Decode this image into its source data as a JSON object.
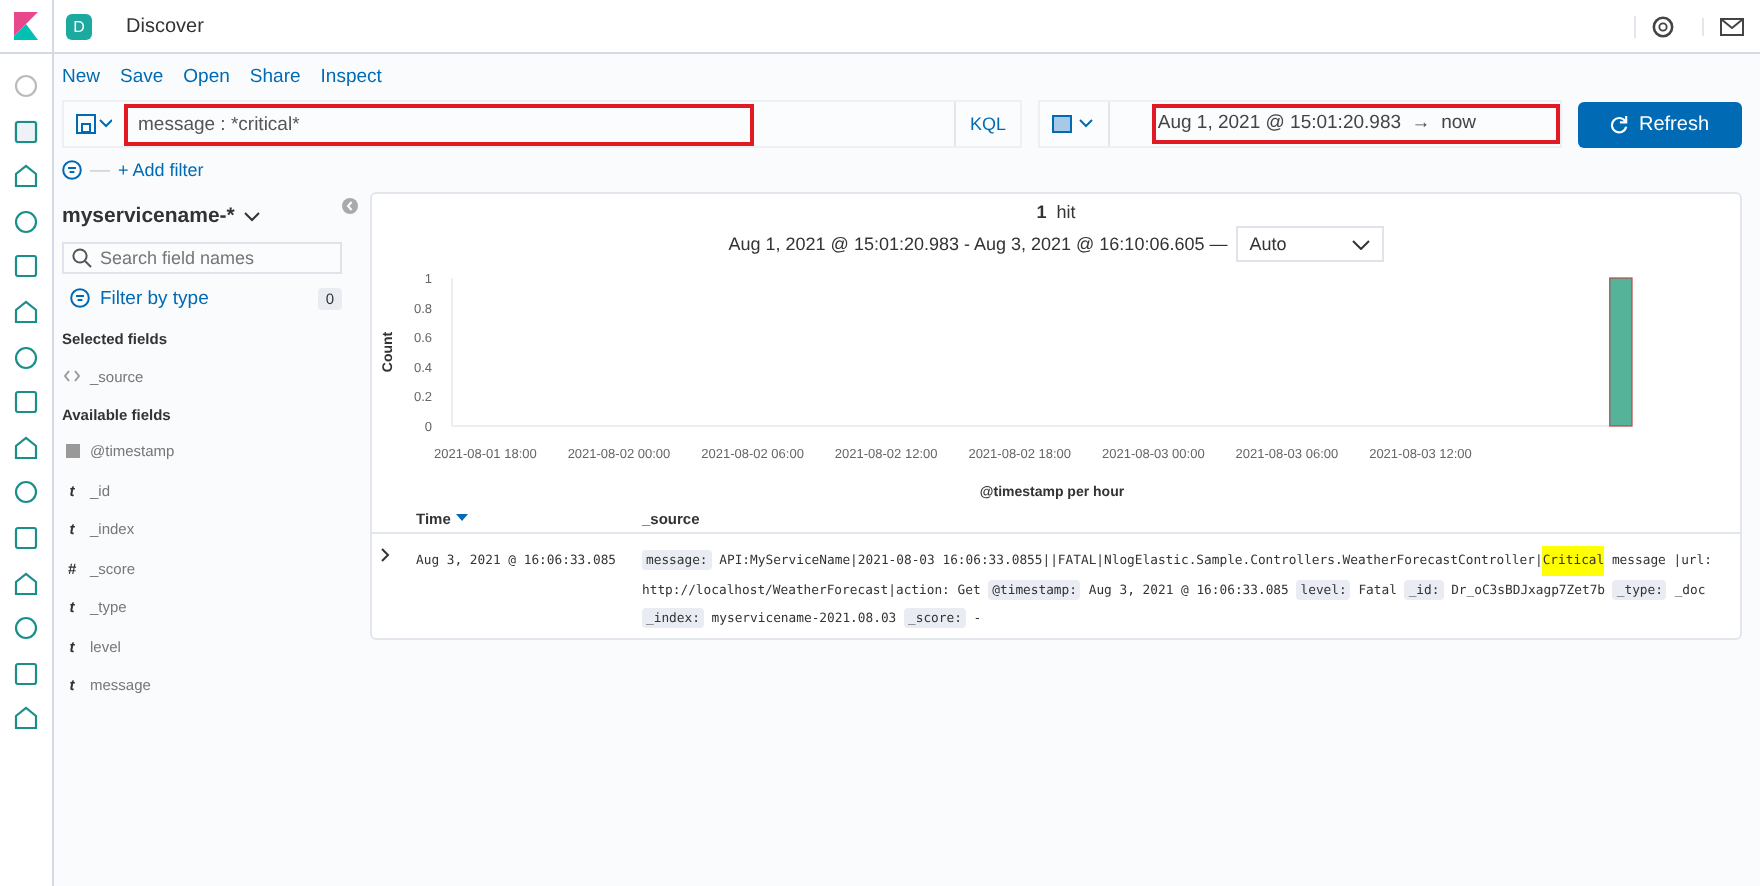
{
  "header": {
    "space_badge": "D",
    "title": "Discover"
  },
  "top_menu": [
    "New",
    "Save",
    "Open",
    "Share",
    "Inspect"
  ],
  "query": {
    "value": "message : *critical*",
    "language": "KQL",
    "highlighted": true
  },
  "time_range": {
    "start": "Aug 1, 2021 @ 15:01:20.983",
    "arrow": "→",
    "end": "now",
    "highlighted": true
  },
  "refresh_button": "Refresh",
  "filter_separator": "—",
  "add_filter": "+ Add filter",
  "sidebar": {
    "index_pattern": "myservicename-*",
    "search": {
      "placeholder": "Search field names"
    },
    "filter_by_type": "Filter by type",
    "filter_count": "0",
    "selected_heading": "Selected fields",
    "selected_fields": [
      {
        "name": "_source",
        "kind": "source"
      }
    ],
    "available_heading": "Available fields",
    "available_fields": [
      {
        "name": "@timestamp",
        "kind": "date"
      },
      {
        "name": "_id",
        "kind": "glyph",
        "glyph": "t"
      },
      {
        "name": "_index",
        "kind": "glyph",
        "glyph": "t"
      },
      {
        "name": "_score",
        "kind": "glyph",
        "glyph": "#"
      },
      {
        "name": "_type",
        "kind": "glyph",
        "glyph": "t"
      },
      {
        "name": "level",
        "kind": "glyph",
        "glyph": "t"
      },
      {
        "name": "message",
        "kind": "glyph",
        "glyph": "t"
      }
    ]
  },
  "results": {
    "hit_count": "1",
    "hit_label": "hit",
    "range_text": "Aug 1, 2021 @ 15:01:20.983 - Aug 3, 2021 @ 16:10:06.605 —",
    "interval": "Auto",
    "chart_data": {
      "type": "bar",
      "xlabel": "@timestamp per hour",
      "ylabel": "Count",
      "categories": [
        null,
        "2021-08-01 18:00",
        null,
        null,
        null,
        null,
        null,
        "2021-08-02 00:00",
        null,
        null,
        null,
        null,
        null,
        "2021-08-02 06:00",
        null,
        null,
        null,
        null,
        null,
        "2021-08-02 12:00",
        null,
        null,
        null,
        null,
        null,
        "2021-08-02 18:00",
        null,
        null,
        null,
        null,
        null,
        "2021-08-03 00:00",
        null,
        null,
        null,
        null,
        null,
        "2021-08-03 06:00",
        null,
        null,
        null,
        null,
        null,
        "2021-08-03 12:00",
        null,
        null,
        null,
        null,
        null,
        null,
        null,
        null,
        null
      ],
      "values": [
        0,
        0,
        0,
        0,
        0,
        0,
        0,
        0,
        0,
        0,
        0,
        0,
        0,
        0,
        0,
        0,
        0,
        0,
        0,
        0,
        0,
        0,
        0,
        0,
        0,
        0,
        0,
        0,
        0,
        0,
        0,
        0,
        0,
        0,
        0,
        0,
        0,
        0,
        0,
        0,
        0,
        0,
        0,
        0,
        0,
        0,
        0,
        0,
        0,
        0,
        0,
        0,
        1
      ],
      "ylim": [
        0,
        1
      ],
      "yticks": [
        0,
        0.2,
        0.4,
        0.6,
        0.8,
        1
      ]
    },
    "columns": [
      {
        "label": "Time",
        "sorted": true
      },
      {
        "label": "_source",
        "sorted": false
      }
    ],
    "rows": [
      {
        "expanded": false,
        "time": "Aug 3, 2021 @ 16:06:33.085",
        "fields": [
          {
            "label": "message:",
            "parts": [
              {
                "text": "API:MyServiceName|2021-08-03 16:06:33.0855||FATAL|NlogElastic.Sample.Controllers.WeatherForecastController|",
                "highlighted": false
              },
              {
                "text": "Critical",
                "highlighted": true
              },
              {
                "text": " message |url:",
                "highlighted": false
              },
              {
                "text": "http://localhost/WeatherForecast|action: Get",
                "highlighted": false
              }
            ]
          },
          {
            "label": "@timestamp:",
            "parts": [
              {
                "text": "Aug 3, 2021 @ 16:06:33.085",
                "highlighted": false
              }
            ]
          },
          {
            "label": "level:",
            "parts": [
              {
                "text": "Fatal",
                "highlighted": false
              }
            ]
          },
          {
            "label": "_id:",
            "parts": [
              {
                "text": "Dr_oC3sBDJxagp7Zet7b",
                "highlighted": false
              }
            ]
          },
          {
            "label": "_type:",
            "parts": [
              {
                "text": "_doc",
                "highlighted": false
              }
            ]
          },
          {
            "label": "_index:",
            "parts": [
              {
                "text": "myservicename-2021.08.03",
                "highlighted": false
              }
            ]
          },
          {
            "label": "_score:",
            "parts": [
              {
                "text": "-",
                "highlighted": false
              }
            ]
          }
        ]
      }
    ]
  }
}
